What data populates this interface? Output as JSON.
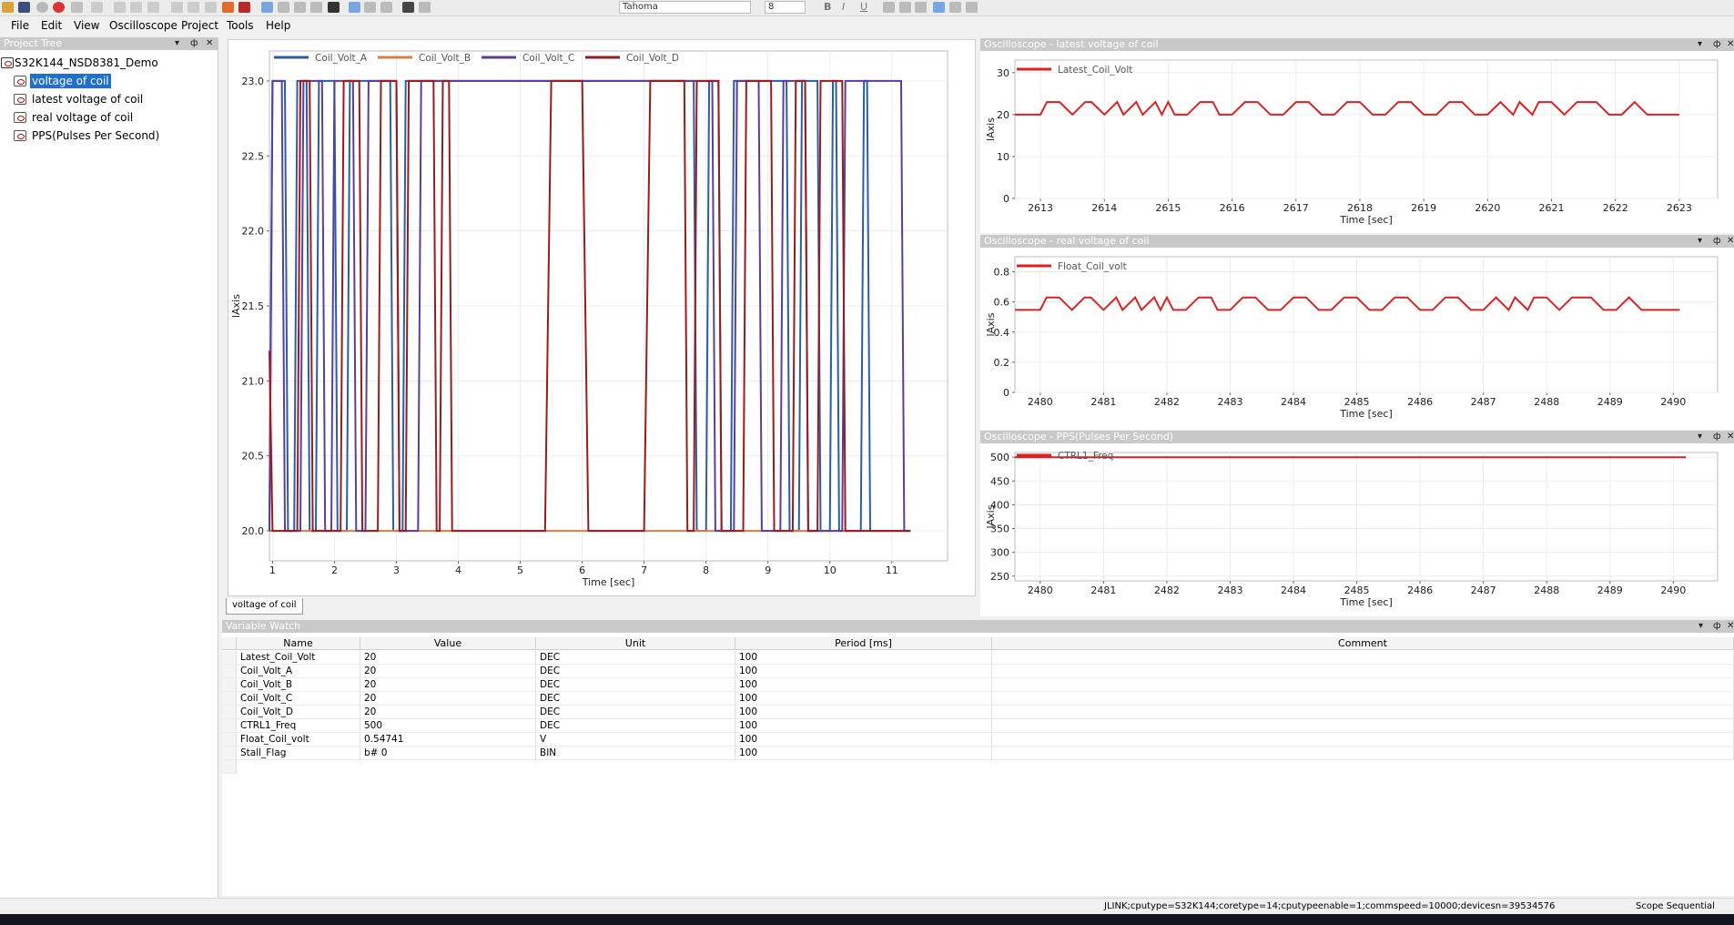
{
  "toolbar": {
    "font_name": "Tahoma",
    "font_size": "8",
    "bold_label": "B",
    "italic_label": "I",
    "underline_label": "U"
  },
  "menu": [
    "File",
    "Edit",
    "View",
    "Oscilloscope",
    "Project",
    "Tools",
    "Help"
  ],
  "project_tree": {
    "title": "Project Tree",
    "root": "S32K144_NSD8381_Demo",
    "items": [
      "voltage of coil",
      "latest voltage of coil",
      "real voltage of coil",
      "PPS(Pulses Per Second)"
    ],
    "selected_index": 0
  },
  "main_tab": "voltage of coil",
  "colors": {
    "coil_a": "#2b5ca8",
    "coil_b": "#e07b39",
    "coil_c": "#5a3d9c",
    "coil_d": "#9b1b1b",
    "scope_line": "#e02020"
  },
  "chart_data": [
    {
      "type": "line",
      "xlabel": "Time [sec]",
      "ylabel": "lAxis",
      "xlim": [
        0.95,
        11.9
      ],
      "ylim": [
        19.8,
        23.2
      ],
      "xticks": [
        "1",
        "2",
        "3",
        "4",
        "5",
        "6",
        "7",
        "8",
        "9",
        "10",
        "11"
      ],
      "yticks": [
        "20.0",
        "20.5",
        "21.0",
        "21.5",
        "22.0",
        "22.5",
        "23.0"
      ],
      "grid": true,
      "legend": "top",
      "series": [
        {
          "name": "Coil_Volt_A",
          "x": [
            0.95,
            1.0,
            1.05,
            1.2,
            1.25,
            1.35,
            1.4,
            1.55,
            1.6,
            1.7,
            1.75,
            2.0,
            2.05,
            2.2,
            2.25,
            2.9,
            2.95,
            3.1,
            3.15,
            7.8,
            7.85,
            8.0,
            8.05,
            8.2,
            8.25,
            8.4,
            8.45,
            9.3,
            9.35,
            9.5,
            9.55,
            9.8,
            9.85,
            10.0,
            10.05,
            10.1,
            10.15,
            10.5,
            10.55,
            10.6,
            10.65,
            11.1,
            11.15,
            11.3
          ],
          "y": [
            20,
            23,
            23,
            23,
            20,
            20,
            23,
            23,
            20,
            20,
            23,
            23,
            20,
            20,
            23,
            23,
            20,
            20,
            23,
            23,
            20,
            20,
            23,
            23,
            20,
            20,
            23,
            23,
            20,
            20,
            23,
            23,
            20,
            20,
            23,
            23,
            20,
            20,
            23,
            23,
            20,
            20,
            20,
            20
          ]
        },
        {
          "name": "Coil_Volt_B",
          "x": [
            0.95,
            11.3
          ],
          "y": [
            20,
            20
          ]
        },
        {
          "name": "Coil_Volt_C",
          "x": [
            0.95,
            1.0,
            1.05,
            1.15,
            1.2,
            1.45,
            1.5,
            1.8,
            1.85,
            1.95,
            2.0,
            2.3,
            2.35,
            2.5,
            2.55,
            3.0,
            3.05,
            3.35,
            3.4,
            8.1,
            8.15,
            8.45,
            8.5,
            8.85,
            8.9,
            9.2,
            9.25,
            9.6,
            9.65,
            10.2,
            10.25,
            11.15,
            11.2,
            11.3
          ],
          "y": [
            20,
            23,
            23,
            23,
            20,
            20,
            23,
            23,
            20,
            20,
            23,
            23,
            20,
            20,
            23,
            23,
            20,
            20,
            23,
            23,
            20,
            20,
            23,
            23,
            20,
            20,
            23,
            23,
            20,
            20,
            23,
            23,
            20,
            20
          ]
        },
        {
          "name": "Coil_Volt_D",
          "x": [
            0.95,
            1.0,
            1.05,
            1.4,
            1.45,
            1.6,
            1.65,
            2.1,
            2.15,
            2.4,
            2.45,
            2.7,
            2.75,
            3.0,
            3.05,
            3.15,
            3.2,
            3.6,
            3.65,
            3.7,
            3.75,
            3.85,
            3.9,
            5.4,
            5.5,
            6.0,
            6.1,
            7.0,
            7.1,
            7.65,
            7.7,
            7.8,
            7.85,
            8.2,
            8.25,
            8.6,
            8.65,
            9.05,
            9.1,
            9.4,
            9.45,
            9.6,
            9.65,
            9.8,
            9.85,
            10.2,
            10.25,
            11.2,
            11.3
          ],
          "y": [
            21.2,
            20,
            20,
            20,
            23,
            23,
            20,
            20,
            23,
            23,
            20,
            20,
            23,
            23,
            20,
            20,
            23,
            23,
            20,
            20,
            23,
            23,
            20,
            20,
            23,
            23,
            20,
            20,
            23,
            23,
            20,
            20,
            23,
            23,
            20,
            20,
            23,
            23,
            20,
            20,
            23,
            23,
            20,
            20,
            23,
            23,
            20,
            20,
            20
          ]
        }
      ]
    },
    {
      "type": "line",
      "title": "Oscilloscope - latest voltage of coil",
      "xlabel": "Time [sec]",
      "ylabel": "lAxis",
      "xlim": [
        2612.6,
        2623.6
      ],
      "ylim": [
        0,
        33
      ],
      "xticks": [
        "2613",
        "2614",
        "2615",
        "2616",
        "2617",
        "2618",
        "2619",
        "2620",
        "2621",
        "2622",
        "2623"
      ],
      "yticks": [
        "0",
        "10",
        "20",
        "30"
      ],
      "legend": "top-left",
      "series": [
        {
          "name": "Latest_Coil_Volt",
          "x": [
            2612.6,
            2613.0,
            2613.1,
            2613.3,
            2613.5,
            2613.7,
            2613.8,
            2614.0,
            2614.2,
            2614.3,
            2614.5,
            2614.6,
            2614.8,
            2614.9,
            2615.0,
            2615.1,
            2615.3,
            2615.5,
            2615.7,
            2615.8,
            2616.0,
            2616.2,
            2616.4,
            2616.6,
            2616.8,
            2617.0,
            2617.2,
            2617.4,
            2617.6,
            2617.8,
            2618.0,
            2618.2,
            2618.4,
            2618.6,
            2618.8,
            2619.0,
            2619.2,
            2619.4,
            2619.6,
            2619.8,
            2620.0,
            2620.2,
            2620.4,
            2620.5,
            2620.7,
            2620.8,
            2621.0,
            2621.2,
            2621.4,
            2621.7,
            2621.9,
            2622.1,
            2622.3,
            2622.5,
            2622.7,
            2622.9,
            2623.0
          ],
          "y": [
            20,
            20,
            23,
            23,
            20,
            23,
            23,
            20,
            23,
            20,
            23,
            20,
            23,
            20,
            23,
            20,
            20,
            23,
            23,
            20,
            20,
            23,
            23,
            20,
            20,
            23,
            23,
            20,
            20,
            23,
            23,
            20,
            20,
            23,
            23,
            20,
            20,
            23,
            23,
            20,
            20,
            23,
            20,
            23,
            20,
            23,
            23,
            20,
            23,
            23,
            20,
            20,
            23,
            20,
            20,
            20,
            20
          ]
        }
      ]
    },
    {
      "type": "line",
      "title": "Oscilloscope - real voltage of coil",
      "xlabel": "Time [sec]",
      "ylabel": "lAxis",
      "xlim": [
        2479.6,
        2490.7
      ],
      "ylim": [
        0,
        0.9
      ],
      "xticks": [
        "2480",
        "2481",
        "2482",
        "2483",
        "2484",
        "2485",
        "2486",
        "2487",
        "2488",
        "2489",
        "2490"
      ],
      "yticks": [
        "0",
        "0.2",
        "0.4",
        "0.6",
        "0.8"
      ],
      "legend": "top-left",
      "series": [
        {
          "name": "Float_Coil_volt",
          "x": [
            2479.6,
            2480.0,
            2480.1,
            2480.3,
            2480.5,
            2480.7,
            2480.8,
            2481.0,
            2481.2,
            2481.3,
            2481.5,
            2481.6,
            2481.8,
            2481.9,
            2482.0,
            2482.1,
            2482.3,
            2482.5,
            2482.7,
            2482.8,
            2483.0,
            2483.2,
            2483.4,
            2483.6,
            2483.8,
            2484.0,
            2484.2,
            2484.4,
            2484.6,
            2484.8,
            2485.0,
            2485.2,
            2485.4,
            2485.6,
            2485.8,
            2486.0,
            2486.2,
            2486.4,
            2486.6,
            2486.8,
            2487.0,
            2487.2,
            2487.4,
            2487.5,
            2487.7,
            2487.8,
            2488.0,
            2488.2,
            2488.4,
            2488.7,
            2488.9,
            2489.1,
            2489.3,
            2489.5,
            2489.7,
            2489.9,
            2490.1
          ],
          "y": [
            0.547,
            0.547,
            0.63,
            0.63,
            0.547,
            0.63,
            0.63,
            0.547,
            0.63,
            0.547,
            0.63,
            0.547,
            0.63,
            0.547,
            0.63,
            0.547,
            0.547,
            0.63,
            0.63,
            0.547,
            0.547,
            0.63,
            0.63,
            0.547,
            0.547,
            0.63,
            0.63,
            0.547,
            0.547,
            0.63,
            0.63,
            0.547,
            0.547,
            0.63,
            0.63,
            0.547,
            0.547,
            0.63,
            0.63,
            0.547,
            0.547,
            0.63,
            0.547,
            0.63,
            0.547,
            0.63,
            0.63,
            0.547,
            0.63,
            0.63,
            0.547,
            0.547,
            0.63,
            0.547,
            0.547,
            0.547,
            0.547
          ]
        }
      ]
    },
    {
      "type": "line",
      "title": "Oscilloscope - PPS(Pulses Per Second)",
      "xlabel": "Time [sec]",
      "ylabel": "lAxis",
      "xlim": [
        2479.6,
        2490.7
      ],
      "ylim": [
        240,
        510
      ],
      "xticks": [
        "2480",
        "2481",
        "2482",
        "2483",
        "2484",
        "2485",
        "2486",
        "2487",
        "2488",
        "2489",
        "2490"
      ],
      "yticks": [
        "250",
        "300",
        "350",
        "400",
        "450",
        "500"
      ],
      "legend": "top-left",
      "series": [
        {
          "name": "CTRL1_Freq",
          "x": [
            2479.6,
            2490.2
          ],
          "y": [
            500,
            500
          ]
        }
      ]
    }
  ],
  "variable_watch": {
    "title": "Variable Watch",
    "columns": [
      "Name",
      "Value",
      "Unit",
      "Period [ms]",
      "Comment"
    ],
    "rows": [
      [
        "Latest_Coil_Volt",
        "20",
        "DEC",
        "100",
        ""
      ],
      [
        "Coil_Volt_A",
        "20",
        "DEC",
        "100",
        ""
      ],
      [
        "Coil_Volt_B",
        "20",
        "DEC",
        "100",
        ""
      ],
      [
        "Coil_Volt_C",
        "20",
        "DEC",
        "100",
        ""
      ],
      [
        "Coil_Volt_D",
        "20",
        "DEC",
        "100",
        ""
      ],
      [
        "CTRL1_Freq",
        "500",
        "DEC",
        "100",
        ""
      ],
      [
        "Float_Coil_volt",
        "0.54741",
        "V",
        "100",
        ""
      ],
      [
        "Stall_Flag",
        "b# 0",
        "BIN",
        "100",
        ""
      ]
    ]
  },
  "status": {
    "connection": "JLINK;cputype=S32K144;coretype=14;cputypeenable=1;commspeed=10000;devicesn=39534576",
    "mode": "Scope Sequential"
  }
}
